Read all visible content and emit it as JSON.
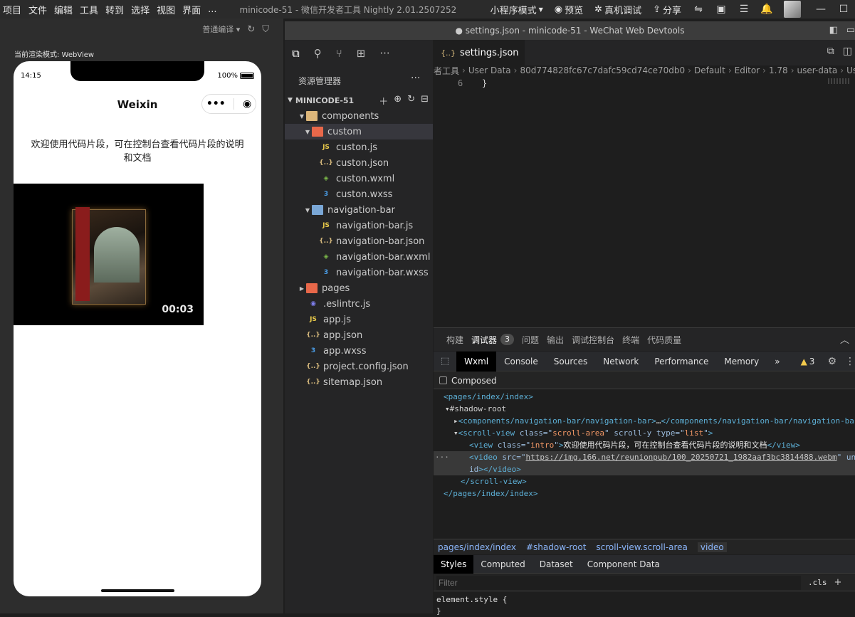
{
  "menubar": {
    "items": [
      "项目",
      "文件",
      "编辑",
      "工具",
      "转到",
      "选择",
      "视图",
      "界面",
      "..."
    ],
    "app_title": "minicode-51 - 微信开发者工具 Nightly 2.01.2507252",
    "mode": "小程序模式",
    "preview": "预览",
    "device_debug": "真机调试",
    "share": "分享"
  },
  "simulator": {
    "compile_mode": "普通编译",
    "render_mode": "当前渲染模式: WebView",
    "status_time": "14:15",
    "battery": "100%",
    "nav_title": "Weixin",
    "intro": "欢迎使用代码片段，可在控制台查看代码片段的说明和文档",
    "video_time": "00:03"
  },
  "explorer": {
    "title": "资源管理器",
    "project": "MINICODE-51",
    "tree": [
      {
        "label": "components",
        "kind": "folder"
      },
      {
        "label": "custom",
        "kind": "folder-red"
      },
      {
        "label": "custon.js",
        "kind": "js"
      },
      {
        "label": "custon.json",
        "kind": "json"
      },
      {
        "label": "custon.wxml",
        "kind": "wxml"
      },
      {
        "label": "custon.wxss",
        "kind": "wxss"
      },
      {
        "label": "navigation-bar",
        "kind": "folder-blue"
      },
      {
        "label": "navigation-bar.js",
        "kind": "js"
      },
      {
        "label": "navigation-bar.json",
        "kind": "json"
      },
      {
        "label": "navigation-bar.wxml",
        "kind": "wxml"
      },
      {
        "label": "navigation-bar.wxss",
        "kind": "wxss"
      },
      {
        "label": "pages",
        "kind": "folder-red"
      },
      {
        "label": ".eslintrc.js",
        "kind": "eslint"
      },
      {
        "label": "app.js",
        "kind": "js"
      },
      {
        "label": "app.json",
        "kind": "json"
      },
      {
        "label": "app.wxss",
        "kind": "wxss"
      },
      {
        "label": "project.config.json",
        "kind": "json"
      },
      {
        "label": "sitemap.json",
        "kind": "json"
      }
    ]
  },
  "editor": {
    "window_title": "● settings.json - minicode-51 - WeChat Web Devtools",
    "tab_label": "settings.json",
    "breadcrumb": [
      "者工具",
      "User Data",
      "80d774828fc67c7dafc59cd74ce70db0",
      "Default",
      "Editor",
      "1.78",
      "user-data",
      "Use"
    ],
    "line_number": "6",
    "line_code": "}"
  },
  "panel": {
    "tabs": [
      "构建",
      "调试器",
      "问题",
      "输出",
      "调试控制台",
      "终端",
      "代码质量"
    ],
    "debugger_badge": "3",
    "devtools_tabs": [
      "Wxml",
      "Console",
      "Sources",
      "Network",
      "Performance",
      "Memory"
    ],
    "more": "»",
    "warn_count": "3",
    "composed_label": "Composed",
    "dom": {
      "pages_open": "<pages/index/index>",
      "shadow_root": "#shadow-root",
      "navbar_open": "<components/navigation-bar/navigation-bar>",
      "navbar_ellipsis": "…",
      "navbar_close": "</components/navigation-bar/navigation-bar>",
      "scroll_tag": "scroll-view",
      "scroll_class_attr": "class",
      "scroll_class_val": "scroll-area",
      "scroll_y_attr": "scroll-y",
      "scroll_type_attr": "type",
      "scroll_type_val": "list",
      "view_tag": "view",
      "view_class_val": "intro",
      "view_text": "欢迎使用代码片段，可在控制台查看代码片段的说明和文档",
      "video_tag": "video",
      "video_src_attr": "src",
      "video_src": "https://img.166.net/reunionpub/100_20250721_1982aaf3bc3814488.webm",
      "video_unid_head": "un",
      "video_unid_tail": "id",
      "scroll_close": "</scroll-view>",
      "pages_close": "</pages/index/index>"
    },
    "dom_breadcrumb": [
      "pages/index/index",
      "#shadow-root",
      "scroll-view.scroll-area",
      "video"
    ],
    "styles_tabs": [
      "Styles",
      "Computed",
      "Dataset",
      "Component Data"
    ],
    "filter_placeholder": "Filter",
    "cls": ".cls",
    "plus": "+",
    "style_rule_line1": "element.style {",
    "style_rule_line2": "}"
  }
}
